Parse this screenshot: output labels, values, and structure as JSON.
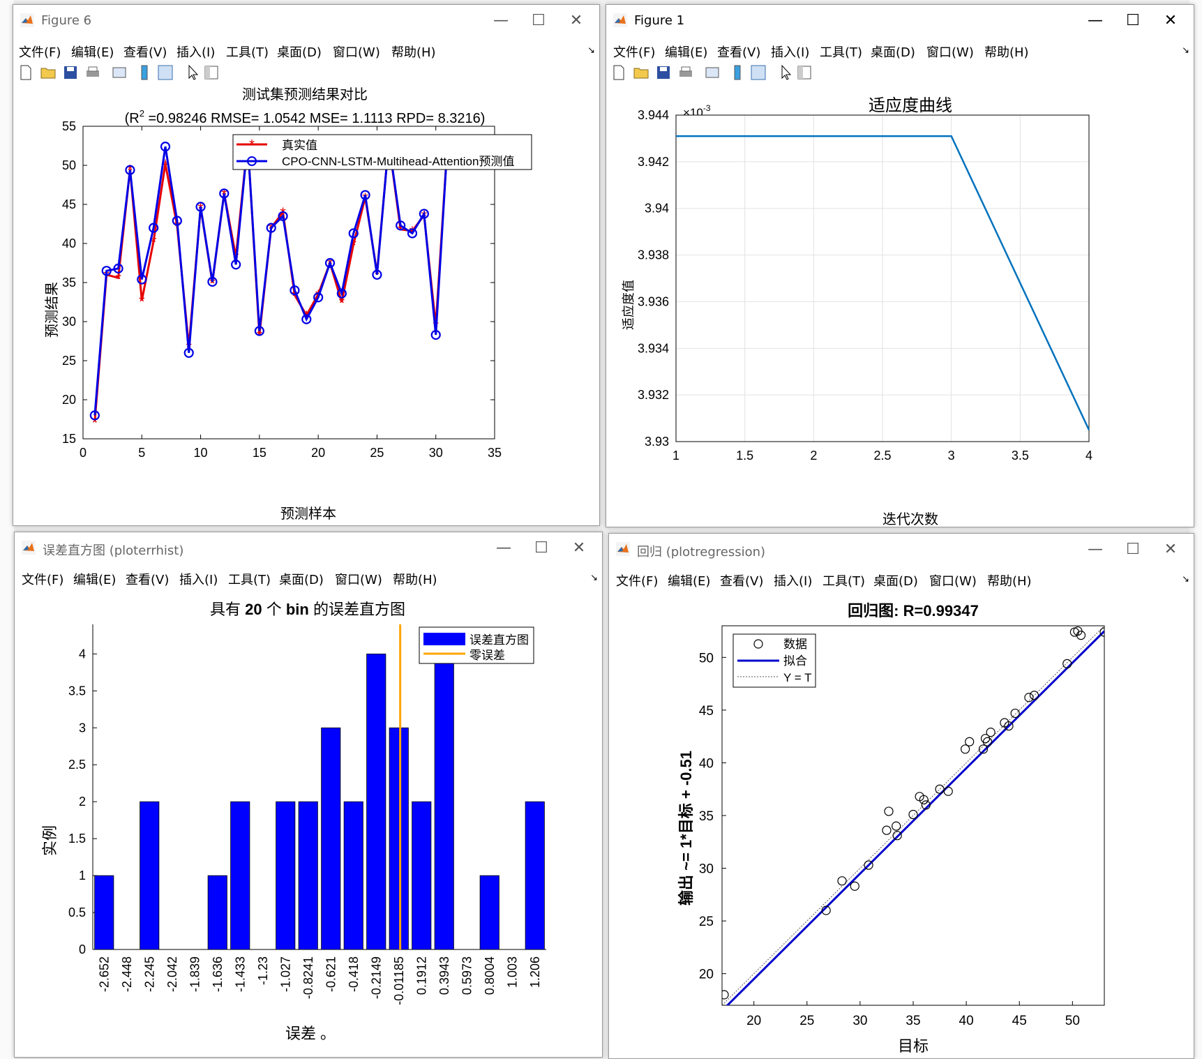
{
  "windows": {
    "figure6": {
      "title": "Figure 6",
      "chart_title": "测试集预测结果对比",
      "subtitle_r": "(R",
      "subtitle_sup": "2",
      "subtitle_rest": " =0.98246 RMSE= 1.0542 MSE= 1.1113 RPD= 8.3216)",
      "xlabel": "预测样本",
      "ylabel": "预测结果",
      "legend": [
        "真实值",
        "CPO-CNN-LSTM-Multihead-Attention预测值"
      ]
    },
    "figure1": {
      "title": "Figure 1",
      "chart_title": "适应度曲线",
      "xlabel": "迭代次数",
      "ylabel": "适应度值",
      "exponent_base": "×10",
      "exponent_power": "-3"
    },
    "errhist": {
      "title": "误差直方图 (ploterrhist)",
      "chart_title_a": "具有 ",
      "chart_title_b": "20",
      "chart_title_c": " 个 ",
      "chart_title_d": "bin",
      "chart_title_e": " 的误差直方图",
      "xlabel": "误差 。",
      "ylabel": "实例",
      "legend": [
        "误差直方图",
        "零误差"
      ]
    },
    "regression": {
      "title": "回归 (plotregression)",
      "chart_title": "回归图: R=0.99347",
      "xlabel": "目标",
      "ylabel": "输出 ~= 1*目标 + -0.51",
      "legend": [
        "数据",
        "拟合",
        "Y = T"
      ]
    }
  },
  "menus": [
    "文件(F)",
    "编辑(E)",
    "查看(V)",
    "插入(I)",
    "工具(T)",
    "桌面(D)",
    "窗口(W)",
    "帮助(H)"
  ],
  "window_controls": {
    "minimize": "—",
    "maximize": "☐",
    "close": "✕"
  },
  "colors": {
    "true_series": "#e60000",
    "pred_series": "#0000e6",
    "fitness_line": "#0072bd",
    "hist_bars": "#0000ff",
    "zero_error": "#ffa500",
    "fit_line": "#0000cc"
  },
  "chart_data": [
    {
      "type": "line",
      "title": "测试集预测结果对比",
      "xlabel": "预测样本",
      "ylabel": "预测结果",
      "xlim": [
        0,
        35
      ],
      "ylim": [
        15,
        55
      ],
      "xticks": [
        0,
        5,
        10,
        15,
        20,
        25,
        30,
        35
      ],
      "yticks": [
        15,
        20,
        25,
        30,
        35,
        40,
        45,
        50,
        55
      ],
      "legend_position": "top-right",
      "x": [
        1,
        2,
        3,
        4,
        5,
        6,
        7,
        8,
        9,
        10,
        11,
        12,
        13,
        14,
        15,
        16,
        17,
        18,
        19,
        20,
        21,
        22,
        23,
        24,
        25,
        26,
        27,
        28,
        29,
        30,
        31
      ],
      "series": [
        {
          "name": "真实值",
          "values": [
            17.2,
            36.0,
            35.6,
            49.5,
            32.7,
            40.3,
            50.2,
            42.3,
            26.8,
            44.6,
            35.0,
            46.4,
            38.3,
            53.0,
            28.3,
            42.0,
            44.0,
            33.4,
            30.8,
            33.5,
            37.5,
            32.5,
            39.9,
            45.9,
            36.2,
            53.0,
            41.8,
            41.6,
            43.6,
            29.5,
            53.0
          ]
        },
        {
          "name": "CPO-CNN-LSTM-Multihead-Attention预测值",
          "values": [
            18.0,
            36.5,
            36.8,
            49.4,
            35.4,
            42.0,
            52.4,
            42.9,
            26.0,
            44.7,
            35.1,
            46.4,
            37.3,
            53.0,
            28.8,
            42.0,
            43.5,
            34.0,
            30.3,
            33.1,
            37.5,
            33.6,
            41.3,
            46.2,
            36.0,
            53.0,
            42.3,
            41.3,
            43.8,
            28.3,
            53.0
          ]
        }
      ]
    },
    {
      "type": "line",
      "title": "适应度曲线",
      "xlabel": "迭代次数",
      "ylabel": "适应度值",
      "xlim": [
        1,
        4
      ],
      "ylim": [
        3.93,
        3.944
      ],
      "y_scale_note": "×10^-3",
      "xticks": [
        1,
        1.5,
        2,
        2.5,
        3,
        3.5,
        4
      ],
      "yticks": [
        3.93,
        3.932,
        3.934,
        3.936,
        3.938,
        3.94,
        3.942,
        3.944
      ],
      "ytick_labels": [
        "3.93",
        "3.932",
        "3.934",
        "3.936",
        "3.938",
        "3.94",
        "3.942",
        "3.944"
      ],
      "grid": true,
      "x": [
        1,
        2,
        3,
        4
      ],
      "series": [
        {
          "values": [
            3.9431,
            3.9431,
            3.9431,
            3.9305
          ]
        }
      ]
    },
    {
      "type": "bar",
      "title": "具有 20 个 bin 的误差直方图",
      "xlabel": "误差 。",
      "ylabel": "实例",
      "ylim": [
        0,
        4.4
      ],
      "yticks": [
        0,
        0.5,
        1,
        1.5,
        2,
        2.5,
        3,
        3.5,
        4
      ],
      "categories": [
        "-2.652",
        "-2.448",
        "-2.245",
        "-2.042",
        "-1.839",
        "-1.636",
        "-1.433",
        "-1.23",
        "-1.027",
        "-0.8241",
        "-0.621",
        "-0.418",
        "-0.2149",
        "-0.01185",
        "0.1912",
        "0.3943",
        "0.5973",
        "0.8004",
        "1.003",
        "1.206"
      ],
      "values": [
        1,
        0,
        2,
        0,
        0,
        1,
        2,
        0,
        2,
        2,
        3,
        2,
        4,
        3,
        2,
        4,
        0,
        1,
        0,
        2
      ],
      "zero_error_x": 0,
      "legend_position": "top-right"
    },
    {
      "type": "scatter",
      "title": "回归图: R=0.99347",
      "xlabel": "目标",
      "ylabel": "输出 ~= 1*目标 + -0.51",
      "xlim": [
        17,
        53
      ],
      "ylim": [
        17,
        53
      ],
      "xticks": [
        20,
        25,
        30,
        35,
        40,
        45,
        50
      ],
      "yticks": [
        20,
        25,
        30,
        35,
        40,
        45,
        50
      ],
      "legend_position": "top-left",
      "points": [
        [
          17.2,
          18.0
        ],
        [
          26.8,
          26.0
        ],
        [
          28.3,
          28.8
        ],
        [
          29.5,
          28.3
        ],
        [
          30.8,
          30.3
        ],
        [
          32.7,
          35.4
        ],
        [
          32.5,
          33.6
        ],
        [
          33.4,
          34.0
        ],
        [
          33.5,
          33.1
        ],
        [
          35.0,
          35.1
        ],
        [
          35.6,
          36.8
        ],
        [
          36.0,
          36.5
        ],
        [
          36.2,
          36.0
        ],
        [
          37.5,
          37.5
        ],
        [
          38.3,
          37.3
        ],
        [
          39.9,
          41.3
        ],
        [
          40.3,
          42.0
        ],
        [
          41.6,
          41.3
        ],
        [
          41.8,
          42.3
        ],
        [
          42.0,
          42.0
        ],
        [
          42.3,
          42.9
        ],
        [
          43.6,
          43.8
        ],
        [
          44.0,
          43.5
        ],
        [
          44.6,
          44.7
        ],
        [
          45.9,
          46.2
        ],
        [
          46.4,
          46.4
        ],
        [
          49.5,
          49.4
        ],
        [
          50.2,
          52.4
        ],
        [
          50.5,
          52.5
        ],
        [
          50.8,
          52.1
        ],
        [
          53.0,
          52.4
        ]
      ],
      "fit": {
        "slope": 1,
        "intercept": -0.51
      }
    }
  ]
}
